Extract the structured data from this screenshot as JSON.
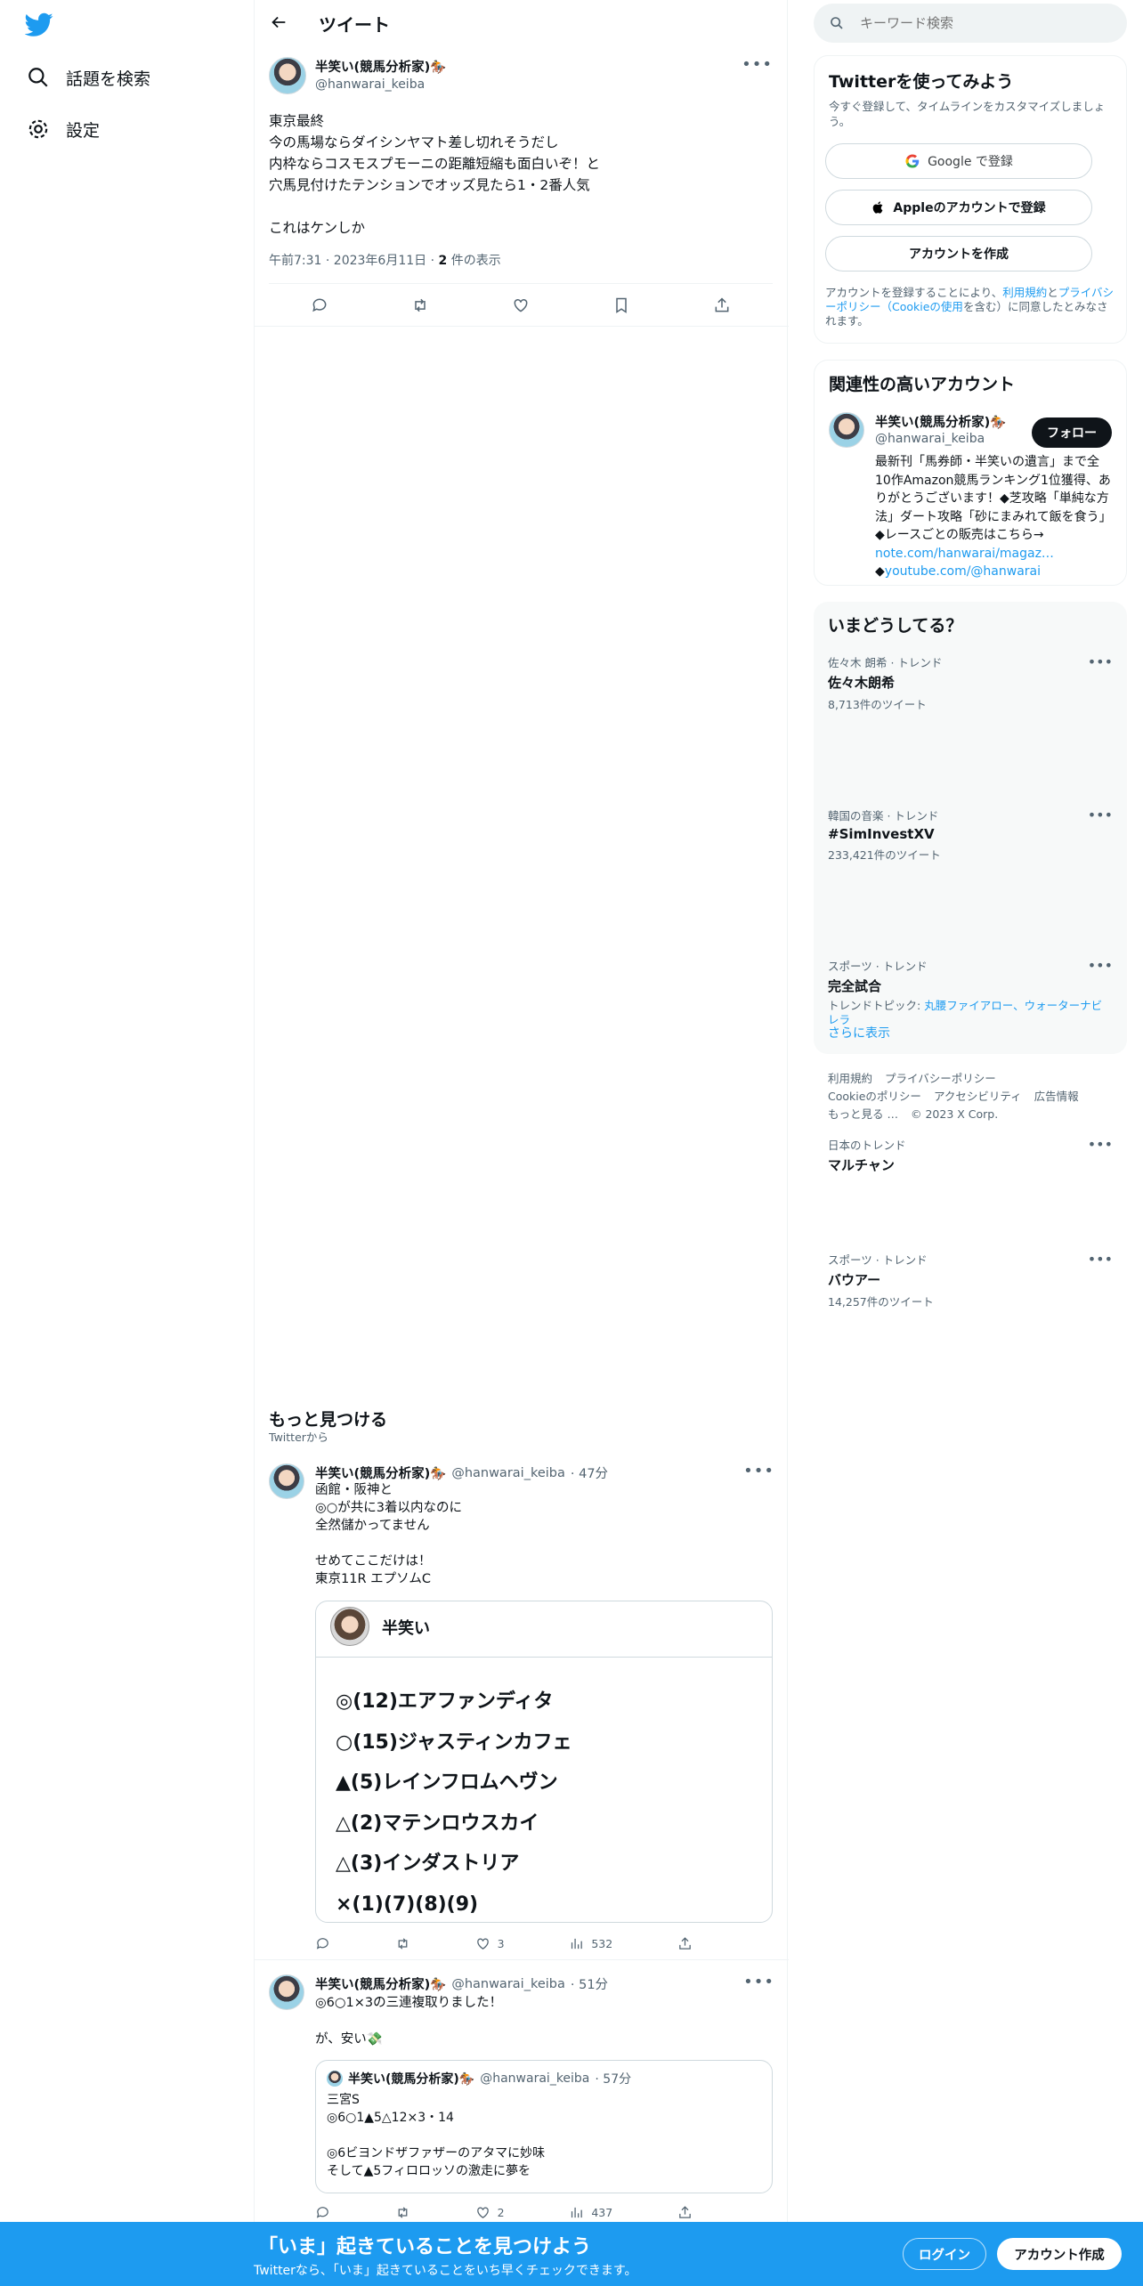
{
  "nav": {
    "explore_label": "話題を検索",
    "settings_label": "設定"
  },
  "header": {
    "title": "ツイート"
  },
  "main_tweet": {
    "author_name": "半笑い(競馬分析家)🏇",
    "author_handle": "@hanwarai_keiba",
    "text": "東京最終\n今の馬場ならダイシンヤマト差し切れそうだし\n内枠ならコスモスプモーニの距離短縮も面白いぞ！と\n穴馬見付けたテンションでオッズ見たら1・2番人気\n\nこれはケンしか",
    "time": "午前7:31 · 2023年6月11日 · ",
    "views_count": "2",
    "views_label": " 件の表示"
  },
  "discover": {
    "title": "もっと見つける",
    "subtitle": "Twitterから",
    "tweets": [
      {
        "author_name": "半笑い(競馬分析家)🏇",
        "author_handle": "@hanwarai_keiba",
        "time": "· 47分",
        "text": "函館・阪神と\n◎○が共に3着以内なのに\n全然儲かってません\n\nせめてここだけは！\n東京11R エプソムC",
        "card": {
          "name": "半笑い",
          "lines": [
            "◎(12)エアファンディタ",
            "○(15)ジャスティンカフェ",
            "▲(5)レインフロムヘヴン",
            "△(2)マテンロウスカイ",
            "△(3)インダストリア",
            "×(1)(7)(8)(9)"
          ]
        },
        "likes": "3",
        "views": "532"
      },
      {
        "author_name": "半笑い(競馬分析家)🏇",
        "author_handle": "@hanwarai_keiba",
        "time": "· 51分",
        "text": "◎6○1×3の三連複取りました！\n\nが、安い💸",
        "quote": {
          "author_name": "半笑い(競馬分析家)🏇",
          "author_handle": "@hanwarai_keiba",
          "time": "· 57分",
          "text": "三宮S\n◎6○1▲5△12×3・14\n\n◎6ビヨンドザファザーのアタマに妙味\nそして▲5フィロロッソの激走に夢を"
        },
        "likes": "2",
        "views": "437"
      }
    ]
  },
  "search": {
    "placeholder": "キーワード検索"
  },
  "signup": {
    "title": "Twitterを使ってみよう",
    "subtitle": "今すぐ登録して、タイムラインをカスタマイズしましょう。",
    "google_label": "Google で登録",
    "apple_label": "Appleのアカウントで登録",
    "create_label": "アカウントを作成",
    "legal_1": "アカウントを登録することにより、",
    "legal_terms": "利用規約",
    "legal_2": "と",
    "legal_privacy": "プライバシーポリシー（Cookieの使用",
    "legal_3": "を含む）に同意したとみなされます。"
  },
  "related": {
    "title": "関連性の高いアカウント",
    "name": "半笑い(競馬分析家)🏇",
    "handle": "@hanwarai_keiba",
    "follow_label": "フォロー",
    "bio": "最新刊「馬券師・半笑いの遺言」まで全10作Amazon競馬ランキング1位獲得、ありがとうございます！◆芝攻略「単純な方法」ダート攻略「砂にまみれて飯を食う」◆レースごとの販売はこちら→ ",
    "bio_link1": "note.com/hanwarai/magaz…",
    "bio_mid": "◆",
    "bio_link2": "youtube.com/@hanwarai"
  },
  "trends": {
    "title": "いまどうしてる？",
    "items": [
      {
        "cat": "佐々木 朗希 · トレンド",
        "name": "佐々木朗希",
        "count": "8,713件のツイート"
      },
      {
        "cat": "韓国の音楽 · トレンド",
        "name": "#SimInvestXV",
        "count": "233,421件のツイート"
      },
      {
        "cat": "スポーツ · トレンド",
        "name": "完全試合",
        "count": "トレンドトピック: ",
        "topics": "丸腰ファイアロー、ウォーターナビレラ"
      },
      {
        "cat": "日本のトレンド",
        "name": "マルチャン",
        "count": ""
      },
      {
        "cat": "スポーツ · トレンド",
        "name": "バウアー",
        "count": "14,257件のツイート"
      }
    ],
    "show_more": "さらに表示"
  },
  "footer": {
    "row1": [
      "利用規約",
      "プライバシーポリシー"
    ],
    "row2": [
      "Cookieのポリシー",
      "アクセシビリティ",
      "広告情報"
    ],
    "more": "もっと見る …",
    "copyright": "© 2023 X Corp."
  },
  "bottom_bar": {
    "title": "「いま」起きていることを見つけよう",
    "subtitle": "Twitterなら、「いま」起きていることをいち早くチェックできます。",
    "login_label": "ログイン",
    "signup_label": "アカウント作成"
  },
  "colors": {
    "accent": "#1d9bf0",
    "text": "#0f1419",
    "muted": "#536471"
  }
}
